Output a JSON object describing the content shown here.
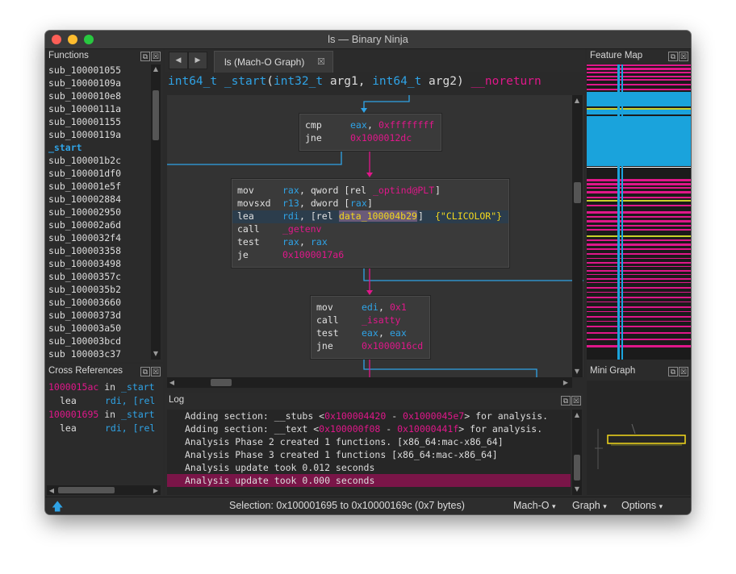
{
  "window": {
    "title": "ls — Binary Ninja"
  },
  "functions_panel": {
    "title": "Functions",
    "items": [
      "sub_100001055",
      "sub_10000109a",
      "sub_1000010e8",
      "sub_10000111a",
      "sub_100001155",
      "sub_10000119a",
      "_start",
      "sub_100001b2c",
      "sub_100001df0",
      "sub_100001e5f",
      "sub_100002884",
      "sub_100002950",
      "sub_100002a6d",
      "sub_1000032f4",
      "sub_100003358",
      "sub_100003498",
      "sub_10000357c",
      "sub_1000035b2",
      "sub_100003660",
      "sub_10000373d",
      "sub_100003a50",
      "sub_100003bcd",
      "sub_100003c37"
    ],
    "selected": "_start"
  },
  "xrefs_panel": {
    "title": "Cross References",
    "entries": [
      {
        "address": "1000015ac",
        "in": "in",
        "func": "_start",
        "mnemonic": "lea",
        "operand": "rdi, [rel"
      },
      {
        "address": "100001695",
        "in": "in",
        "func": "_start",
        "mnemonic": "lea",
        "operand": "rdi, [rel"
      }
    ]
  },
  "tabs": [
    {
      "label": "ls (Mach-O Graph)",
      "close": "☒"
    }
  ],
  "nav": {
    "back": "◀",
    "forward": "▶"
  },
  "signature": {
    "ret": "int64_t",
    "name": "_start",
    "open": "(",
    "p1_type": "int32_t",
    "p1": "arg1",
    "comma": ",",
    "p2_type": "int64_t",
    "p2": "arg2",
    "close": ")",
    "attr": "__noreturn"
  },
  "blocks": {
    "b1": [
      {
        "mn": "cmp",
        "a": "eax",
        "s": ",",
        "b": "0xffffffff"
      },
      {
        "mn": "jne",
        "a": "0x1000012dc"
      }
    ],
    "b2": [
      {
        "mn": "mov",
        "a": "rax",
        "s": ", qword [rel",
        "b": "_optind@PLT",
        "e": "]"
      },
      {
        "mn": "movsxd",
        "a": "r13",
        "s": ", dword [",
        "b": "rax",
        "e": "]"
      },
      {
        "mn": "lea",
        "a": "rdi",
        "s": ", [rel",
        "b": "data_100004b29",
        "e": "]",
        "c": "{\"CLICOLOR\"}"
      },
      {
        "mn": "call",
        "a": "_getenv"
      },
      {
        "mn": "test",
        "a": "rax",
        "s": ",",
        "b": "rax"
      },
      {
        "mn": "je",
        "a": "0x1000017a6"
      }
    ],
    "b3": [
      {
        "mn": "mov",
        "a": "edi",
        "s": ",",
        "b": "0x1"
      },
      {
        "mn": "call",
        "a": "_isatty"
      },
      {
        "mn": "test",
        "a": "eax",
        "s": ",",
        "b": "eax"
      },
      {
        "mn": "jne",
        "a": "0x1000016cd"
      }
    ]
  },
  "log": {
    "title": "Log",
    "lines": [
      {
        "pre": "Adding section: __stubs <",
        "a": "0x100004420",
        "mid": " - ",
        "b": "0x1000045e7",
        "post": "> for analysis."
      },
      {
        "pre": "Adding section: __text <",
        "a": "0x100000f08",
        "mid": " - ",
        "b": "0x10000441f",
        "post": "> for analysis."
      },
      {
        "text": "Analysis Phase 2 created 1 functions. [x86_64:mac-x86_64]"
      },
      {
        "text": "Analysis Phase 3 created 1 functions [x86_64:mac-x86_64]"
      },
      {
        "text": "Analysis update took 0.012 seconds"
      },
      {
        "text": "Analysis update took 0.000 seconds",
        "highlight": true
      }
    ]
  },
  "feature_map": {
    "title": "Feature Map"
  },
  "mini_graph": {
    "title": "Mini Graph"
  },
  "panel_buttons": {
    "float": "⧉",
    "close": "☒"
  },
  "status": {
    "selection": "Selection: 0x100001695 to 0x10000169c (0x7 bytes)",
    "format": "Mach-O",
    "view": "Graph",
    "options": "Options",
    "caret": "▾",
    "up_icon": "🡅"
  },
  "colors": {
    "accent_blue": "#2fa3e6",
    "accent_pink": "#e0178a",
    "string_yellow": "#f4d91c",
    "highlight_row": "#7a1548"
  }
}
